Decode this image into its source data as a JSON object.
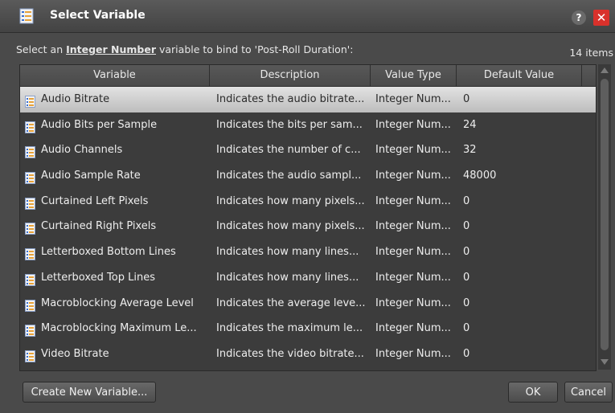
{
  "dialog": {
    "title": "Select Variable",
    "help_label": "?",
    "close_label": "✕"
  },
  "instruction": {
    "prefix": "Select an ",
    "type": "Integer Number",
    "suffix": " variable to bind to 'Post-Roll Duration':"
  },
  "item_count": "14 items",
  "columns": {
    "variable": "Variable",
    "description": "Description",
    "value_type": "Value Type",
    "default_value": "Default Value"
  },
  "rows": [
    {
      "name": "Audio Bitrate",
      "description": "Indicates the audio bitrate...",
      "type": "Integer Num...",
      "default": "0"
    },
    {
      "name": "Audio Bits per Sample",
      "description": "Indicates the bits per sam...",
      "type": "Integer Num...",
      "default": "24"
    },
    {
      "name": "Audio Channels",
      "description": "Indicates the number of c...",
      "type": "Integer Num...",
      "default": "32"
    },
    {
      "name": "Audio Sample Rate",
      "description": "Indicates the audio sampl...",
      "type": "Integer Num...",
      "default": "48000"
    },
    {
      "name": "Curtained Left Pixels",
      "description": "Indicates how many pixels...",
      "type": "Integer Num...",
      "default": "0"
    },
    {
      "name": "Curtained Right Pixels",
      "description": "Indicates how many pixels...",
      "type": "Integer Num...",
      "default": "0"
    },
    {
      "name": "Letterboxed Bottom Lines",
      "description": "Indicates how many lines...",
      "type": "Integer Num...",
      "default": "0"
    },
    {
      "name": "Letterboxed Top Lines",
      "description": "Indicates how many lines...",
      "type": "Integer Num...",
      "default": "0"
    },
    {
      "name": "Macroblocking Average Level",
      "description": "Indicates the average leve...",
      "type": "Integer Num...",
      "default": "0"
    },
    {
      "name": "Macroblocking Maximum Le...",
      "description": "Indicates the maximum le...",
      "type": "Integer Num...",
      "default": "0"
    },
    {
      "name": "Video Bitrate",
      "description": "Indicates the video bitrate...",
      "type": "Integer Num...",
      "default": "0"
    }
  ],
  "selected_row": 0,
  "buttons": {
    "create": "Create New Variable...",
    "ok": "OK",
    "cancel": "Cancel"
  },
  "colors": {
    "background": "#4a4a4a",
    "selection": "#d6d6d6",
    "close": "#d9312b"
  },
  "icons": {
    "app": "variable-list-icon",
    "row": "variable-icon"
  }
}
